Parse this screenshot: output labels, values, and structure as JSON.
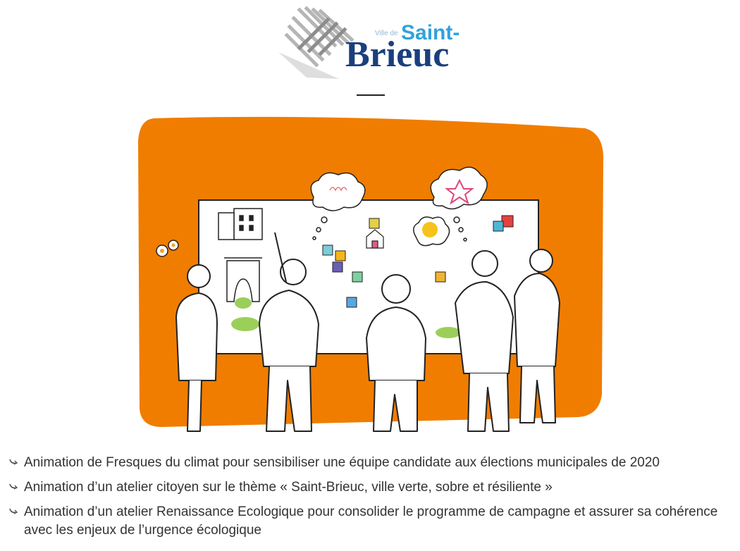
{
  "logo": {
    "prefix": "Ville de",
    "line1": "Saint-",
    "line2": "Brieuc"
  },
  "list_items": [
    "Animation de Fresques du climat pour sensibiliser une équipe candidate aux élections municipales de 2020",
    "Animation d’un atelier citoyen sur le thème « Saint-Brieuc, ville verte, sobre et résiliente »",
    "Animation d’un atelier Renaissance Ecologique pour consolider le programme de campagne et assurer sa cohérence avec les enjeux de l’urgence écologique"
  ],
  "colors": {
    "orange": "#f07d00",
    "logo_dark": "#1a3f7e",
    "logo_light": "#2fa2dc"
  }
}
